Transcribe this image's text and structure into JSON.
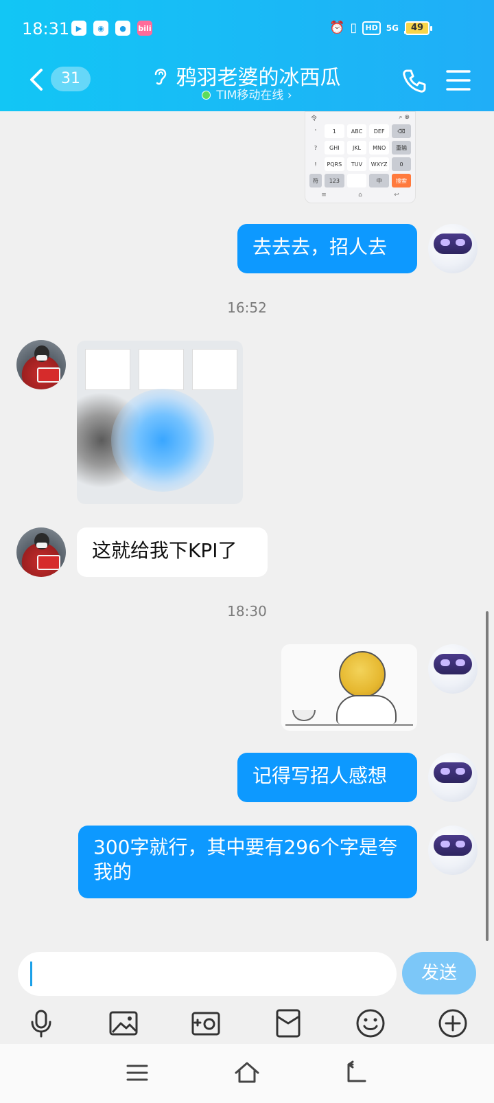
{
  "status_bar": {
    "time": "18:31",
    "network": "5G",
    "hd": "HD",
    "battery": "49"
  },
  "header": {
    "unread_count": "31",
    "title": "鸦羽老婆的冰西瓜",
    "subtitle": "TIM移动在线 ›"
  },
  "messages": [
    {
      "type": "image",
      "side": "out",
      "description": "keyboard-screenshot"
    },
    {
      "type": "text",
      "side": "out",
      "text": "去去去，招人去"
    },
    {
      "type": "timestamp",
      "text": "16:52"
    },
    {
      "type": "image",
      "side": "in",
      "description": "sticker"
    },
    {
      "type": "text",
      "side": "in",
      "text": "这就给我下KPI了"
    },
    {
      "type": "timestamp",
      "text": "18:30"
    },
    {
      "type": "image",
      "side": "out",
      "description": "sticker"
    },
    {
      "type": "text",
      "side": "out",
      "text": "记得写招人感想"
    },
    {
      "type": "text",
      "side": "out",
      "text": "300字就行，其中要有296个字是夸我的"
    }
  ],
  "keyboard_screenshot": {
    "keys": [
      "1",
      "ABC",
      "DEF",
      "GHI",
      "JKL",
      "MNO",
      "PQRS",
      "TUV",
      "WXYZ",
      "123",
      "中",
      "0",
      "符",
      "搜索"
    ]
  },
  "input": {
    "value": "",
    "send_label": "发送"
  },
  "toolbar": [
    "mic-icon",
    "image-icon",
    "camera-icon",
    "red-packet-icon",
    "emoji-icon",
    "plus-icon"
  ],
  "nav": [
    "menu-icon",
    "home-icon",
    "back-icon"
  ],
  "colors": {
    "header": "#20aef7",
    "bubble_out": "#0d99ff",
    "bubble_in": "#ffffff",
    "send_button": "#7cc7f8"
  }
}
